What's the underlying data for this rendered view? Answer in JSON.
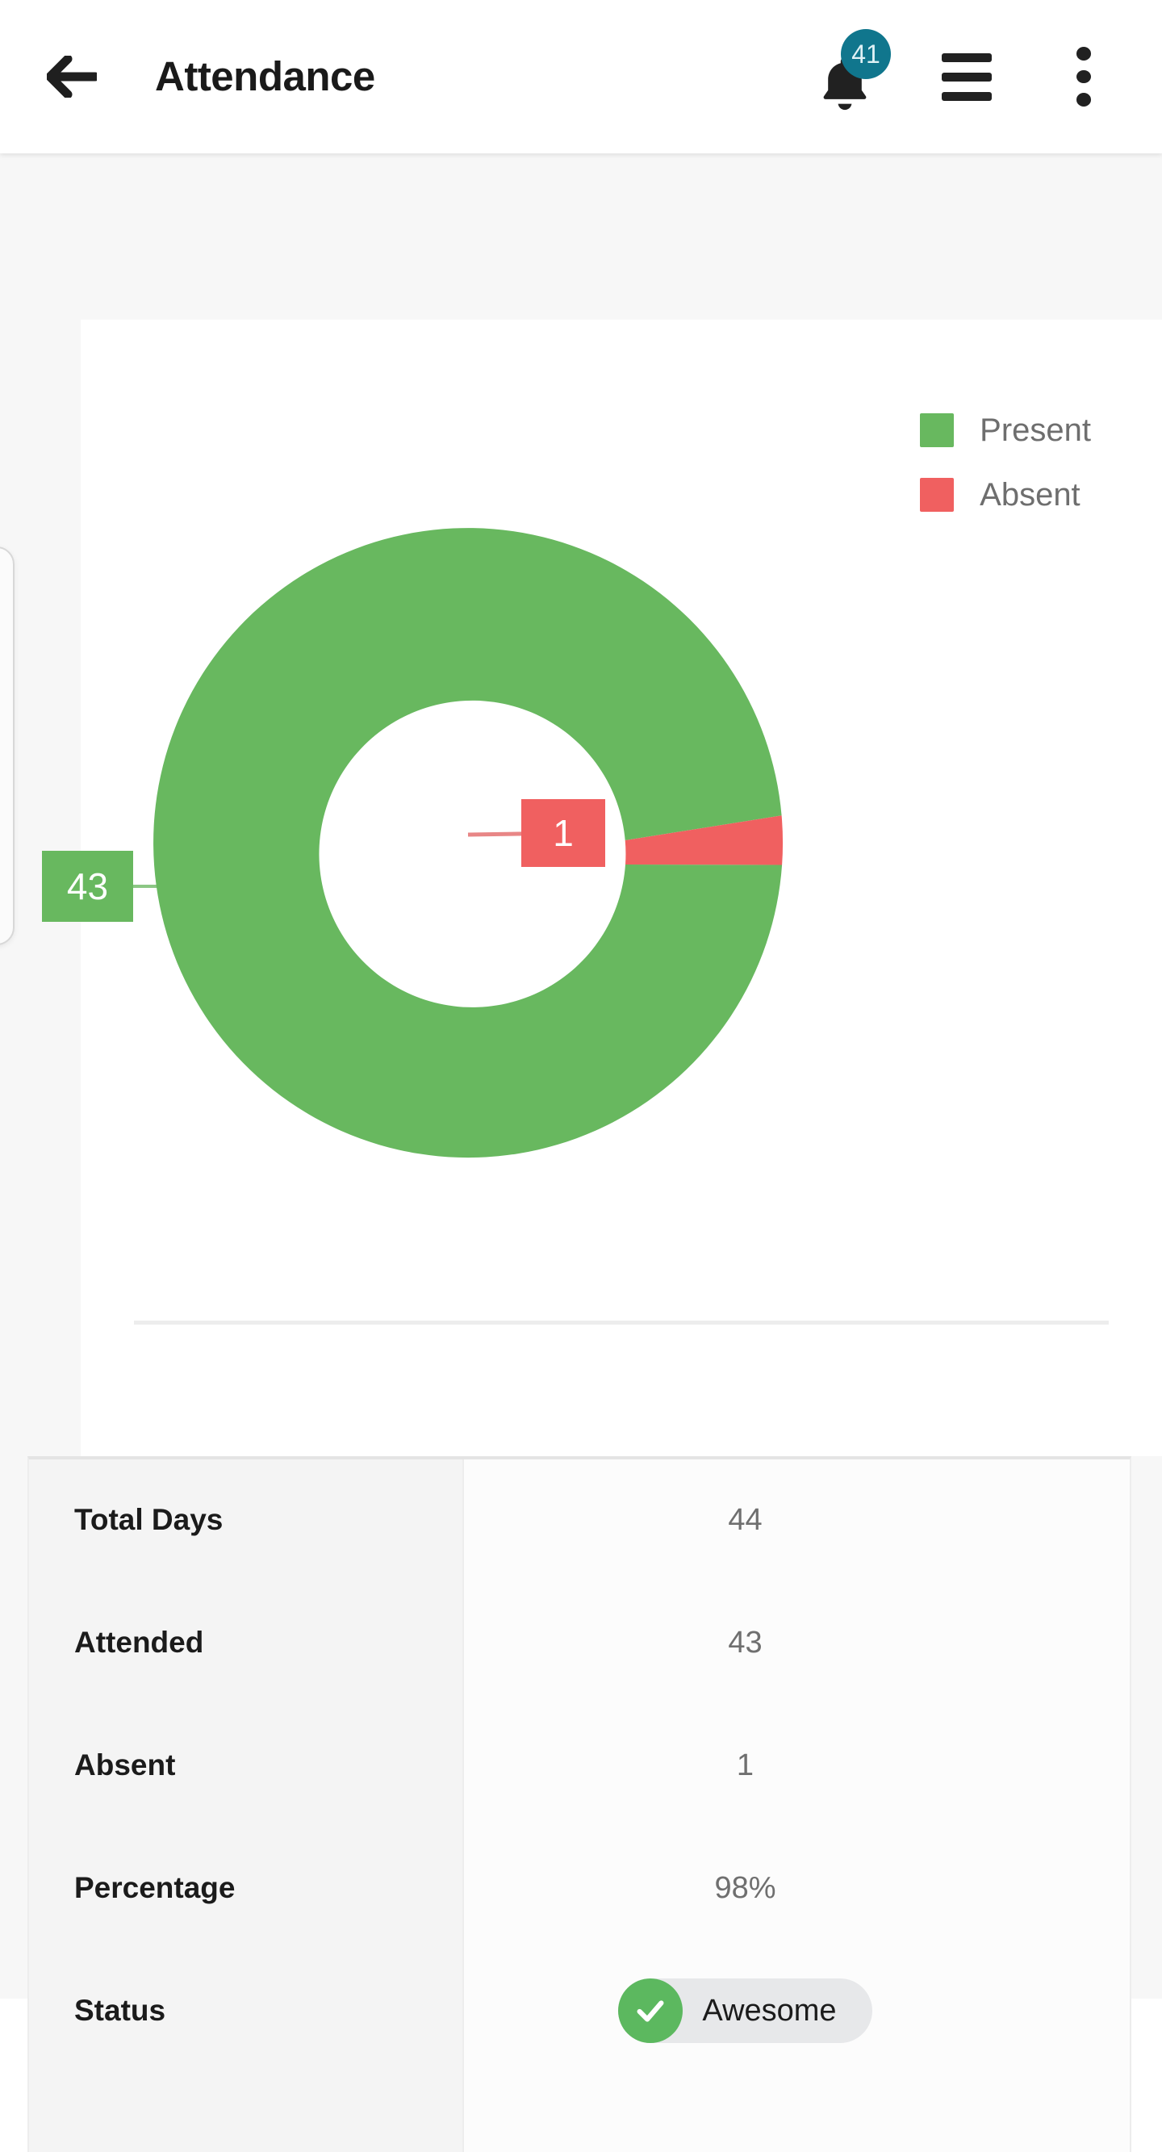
{
  "appbar": {
    "title": "Attendance",
    "back_icon": "arrow-left-icon",
    "notifications": {
      "icon": "bell-icon",
      "badge_count": "41",
      "badge_color": "#10768d"
    },
    "menu_icon": "hamburger-menu-icon",
    "overflow_icon": "more-vertical-icon"
  },
  "chart_data": {
    "type": "pie",
    "variant": "donut",
    "title": "",
    "labels": [
      "Present",
      "Absent"
    ],
    "values": [
      43,
      1
    ],
    "colors": [
      "#68b85f",
      "#f06060"
    ],
    "data_labels": [
      "43",
      "1"
    ],
    "total": 44,
    "legend_position": "top-right",
    "grid": false,
    "legend": [
      {
        "label": "Present",
        "color": "#68b85f"
      },
      {
        "label": "Absent",
        "color": "#f06060"
      }
    ]
  },
  "stats": {
    "rows": [
      {
        "label": "Total Days",
        "value": "44"
      },
      {
        "label": "Attended",
        "value": "43"
      },
      {
        "label": "Absent",
        "value": "1"
      },
      {
        "label": "Percentage",
        "value": "98%"
      },
      {
        "label": "Status",
        "value": "Awesome",
        "type": "chip",
        "chip_icon": "check-icon",
        "chip_color": "#5cb85f"
      }
    ]
  }
}
